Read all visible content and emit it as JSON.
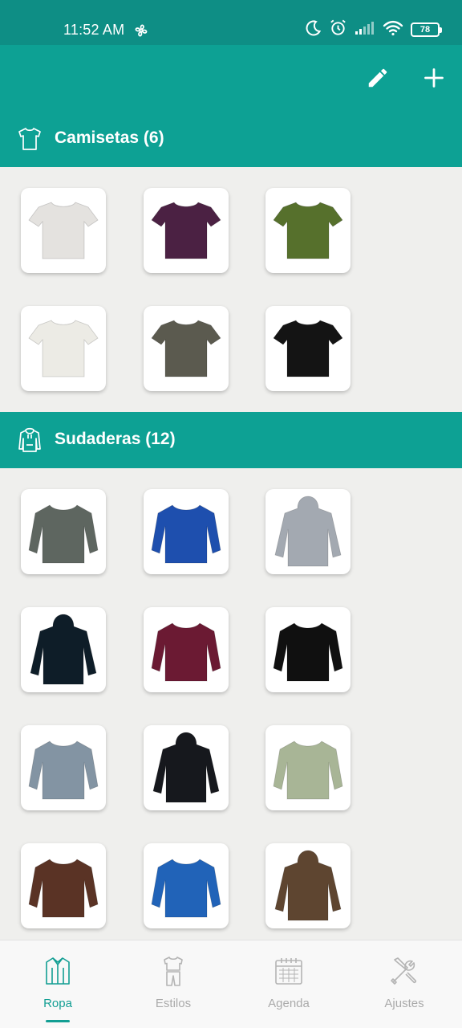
{
  "status_bar": {
    "time": "11:52 AM",
    "battery": "78",
    "icons": [
      "fan-icon",
      "moon-icon",
      "alarm-icon",
      "signal-icon",
      "wifi-icon",
      "battery-icon"
    ]
  },
  "toolbar": {
    "actions": [
      "edit-icon",
      "add-icon"
    ]
  },
  "sections": [
    {
      "title": "Camisetas (6)",
      "icon": "tshirt-icon",
      "items": [
        {
          "kind": "tshirt",
          "color": "#e4e2df"
        },
        {
          "kind": "tshirt",
          "color": "#4b2143"
        },
        {
          "kind": "tshirt",
          "color": "#56702c"
        },
        {
          "kind": "tshirt",
          "color": "#ecebe5"
        },
        {
          "kind": "tshirt",
          "color": "#5b5a4f"
        },
        {
          "kind": "tshirt",
          "color": "#141414"
        }
      ]
    },
    {
      "title": "Sudaderas (12)",
      "icon": "hoodie-icon",
      "items": [
        {
          "kind": "sweatshirt",
          "color": "#5e6660"
        },
        {
          "kind": "sweatshirt",
          "color": "#1e4fae"
        },
        {
          "kind": "hoodie",
          "color": "#a3a9b1"
        },
        {
          "kind": "hoodie",
          "color": "#0e1d28"
        },
        {
          "kind": "sweatshirt",
          "color": "#6b1a33"
        },
        {
          "kind": "sweatshirt",
          "color": "#101010"
        },
        {
          "kind": "sweatshirt",
          "color": "#8394a3"
        },
        {
          "kind": "hoodie",
          "color": "#16181d"
        },
        {
          "kind": "sweatshirt",
          "color": "#a8b596"
        },
        {
          "kind": "sweatshirt",
          "color": "#5a3325"
        },
        {
          "kind": "sweatshirt",
          "color": "#2163b8"
        },
        {
          "kind": "hoodie",
          "color": "#5e4530"
        }
      ]
    }
  ],
  "bottom_nav": [
    {
      "label": "Ropa",
      "icon": "shirt-icon",
      "active": true
    },
    {
      "label": "Estilos",
      "icon": "outfit-icon",
      "active": false
    },
    {
      "label": "Agenda",
      "icon": "calendar-icon",
      "active": false
    },
    {
      "label": "Ajustes",
      "icon": "tools-icon",
      "active": false
    }
  ],
  "colors": {
    "status_bar": "#0e8e85",
    "primary": "#0da194",
    "accent": "#129e93",
    "background": "#efefed",
    "inactive": "#aaaaaa"
  }
}
